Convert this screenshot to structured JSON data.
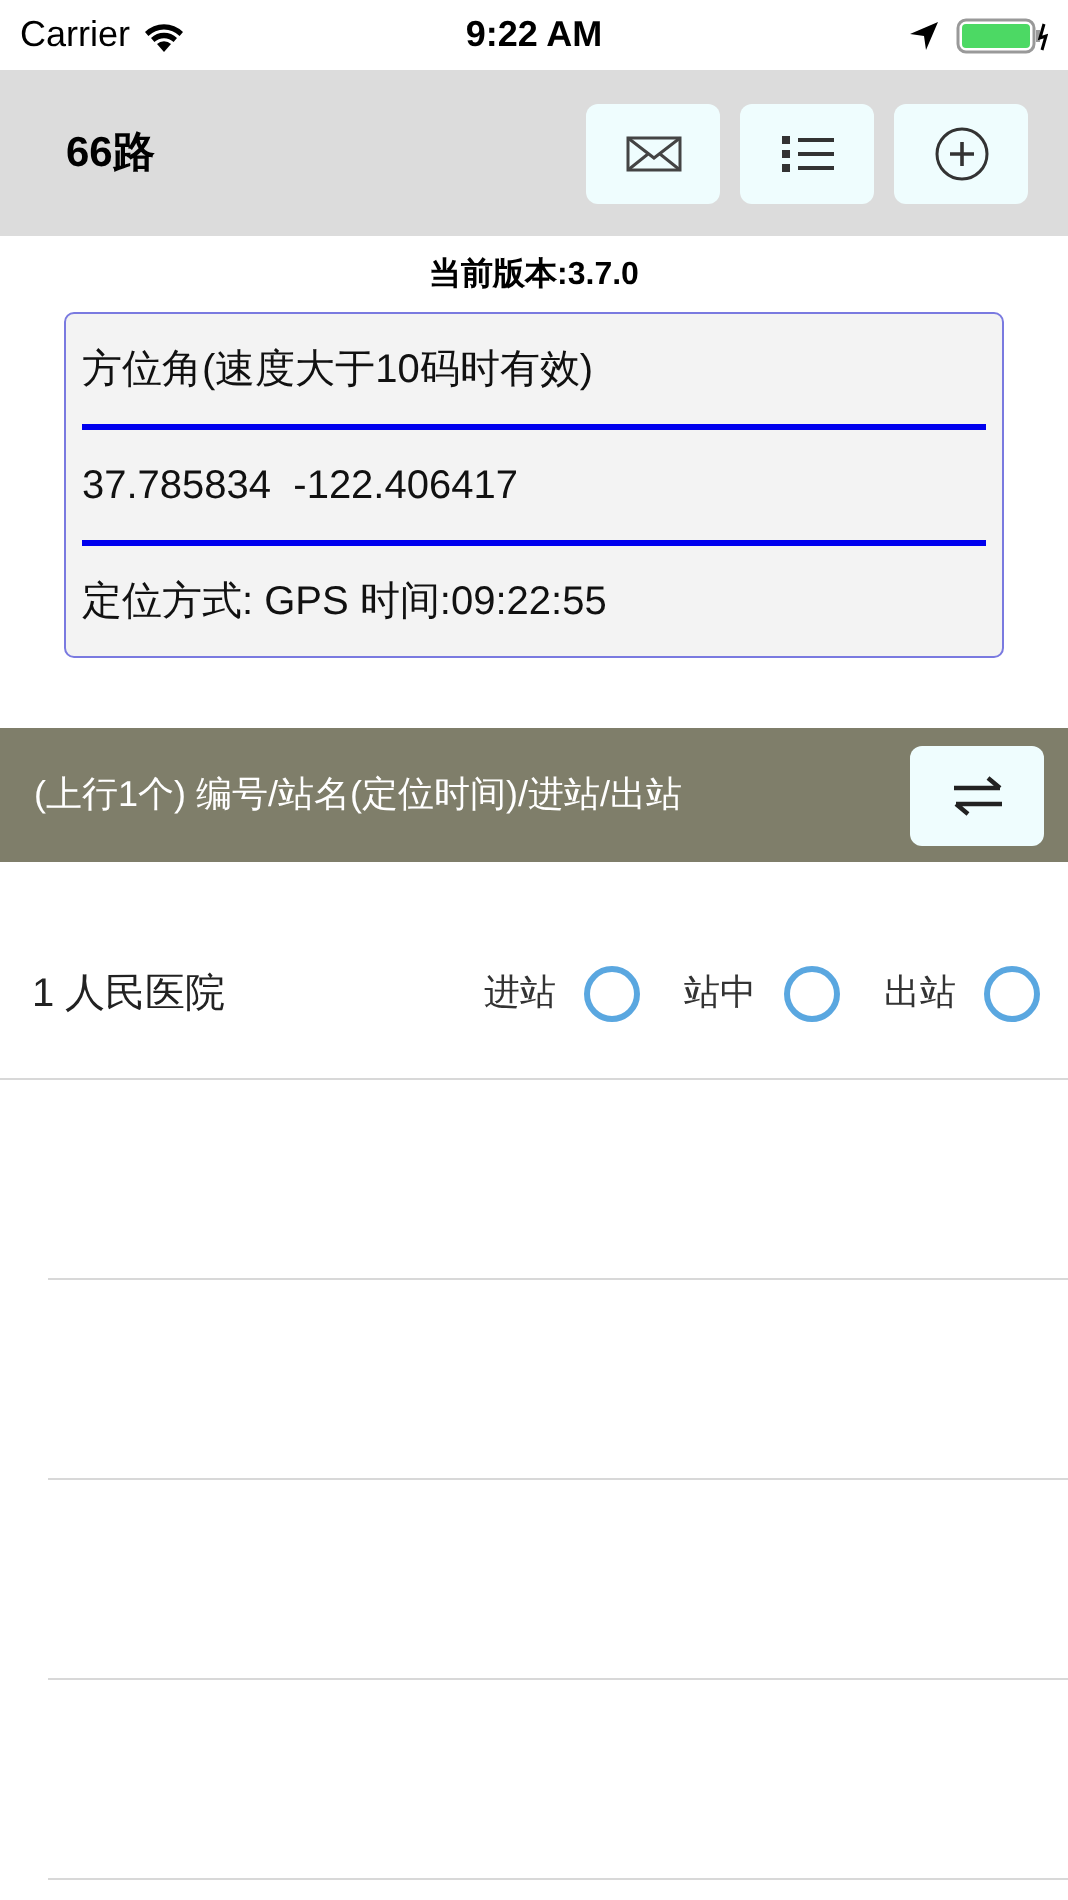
{
  "status_bar": {
    "carrier": "Carrier",
    "time": "9:22 AM"
  },
  "nav_bar": {
    "title": "66路"
  },
  "version": "当前版本:3.7.0",
  "info_box": {
    "lines": [
      "方位角(速度大于10码时有效)",
      "37.785834  -122.406417",
      "定位方式: GPS 时间:09:22:55"
    ]
  },
  "list_header": {
    "label": "(上行1个) 编号/站名(定位时间)/进站/出站"
  },
  "stations": [
    {
      "name": "1 人民医院",
      "options": [
        {
          "label": "进站",
          "selected": false
        },
        {
          "label": "站中",
          "selected": false
        },
        {
          "label": "出站",
          "selected": false
        }
      ]
    }
  ]
}
